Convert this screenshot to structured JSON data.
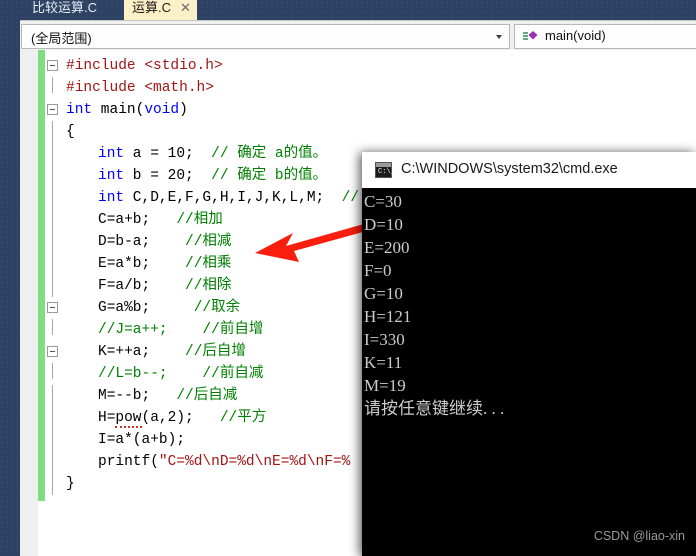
{
  "window": {
    "tabs": [
      {
        "label": "比较运算.C",
        "active": false,
        "closable": false
      },
      {
        "label": "运算.C",
        "active": true,
        "closable": true,
        "close_glyph": "✕"
      }
    ]
  },
  "navbar": {
    "scope_value": "(全局范围)",
    "member_value": "main(void)",
    "scope_icon": "chevron-down-icon",
    "member_icon": "method-purple-icon"
  },
  "editor": {
    "language": "c",
    "lines": [
      {
        "indent": 0,
        "fold": "collapse",
        "tokens": [
          {
            "t": "#include ",
            "c": "pp"
          },
          {
            "t": "<stdio.h>",
            "c": "pp"
          }
        ]
      },
      {
        "indent": 0,
        "fold": "end",
        "tokens": [
          {
            "t": "#include ",
            "c": "pp"
          },
          {
            "t": "<math.h>",
            "c": "pp"
          }
        ]
      },
      {
        "indent": 0,
        "fold": "collapse",
        "tokens": [
          {
            "t": "int",
            "c": "k"
          },
          {
            "t": " main(",
            "c": "pl"
          },
          {
            "t": "void",
            "c": "k"
          },
          {
            "t": ")",
            "c": "pl"
          }
        ]
      },
      {
        "indent": 0,
        "fold": "bar",
        "tokens": [
          {
            "t": "{",
            "c": "pl"
          }
        ]
      },
      {
        "indent": 1,
        "fold": "bar",
        "tokens": [
          {
            "t": "int",
            "c": "k"
          },
          {
            "t": " a = 10;  ",
            "c": "pl"
          },
          {
            "t": "// 确定 a的值。",
            "c": "cm"
          }
        ]
      },
      {
        "indent": 1,
        "fold": "bar",
        "tokens": [
          {
            "t": "int",
            "c": "k"
          },
          {
            "t": " b = 20;  ",
            "c": "pl"
          },
          {
            "t": "// 确定 b的值。",
            "c": "cm"
          }
        ]
      },
      {
        "indent": 1,
        "fold": "bar",
        "tokens": [
          {
            "t": "int",
            "c": "k"
          },
          {
            "t": " C,D,E,F,G,H,I,J,K,L,M;  ",
            "c": "pl"
          },
          {
            "t": "//",
            "c": "cm"
          }
        ]
      },
      {
        "indent": 1,
        "fold": "bar",
        "tokens": [
          {
            "t": "C=a+b;   ",
            "c": "pl"
          },
          {
            "t": "//相加",
            "c": "cm"
          }
        ]
      },
      {
        "indent": 1,
        "fold": "bar",
        "tokens": [
          {
            "t": "D=b-a;    ",
            "c": "pl"
          },
          {
            "t": "//相减",
            "c": "cm"
          }
        ]
      },
      {
        "indent": 1,
        "fold": "bar",
        "tokens": [
          {
            "t": "E=a*b;    ",
            "c": "pl"
          },
          {
            "t": "//相乘",
            "c": "cm"
          }
        ]
      },
      {
        "indent": 1,
        "fold": "bar",
        "tokens": [
          {
            "t": "F=a/b;    ",
            "c": "pl"
          },
          {
            "t": "//相除",
            "c": "cm"
          }
        ]
      },
      {
        "indent": 1,
        "fold": "collapse",
        "tokens": [
          {
            "t": "G=a%b;     ",
            "c": "pl"
          },
          {
            "t": "//取余",
            "c": "cm"
          }
        ]
      },
      {
        "indent": 1,
        "fold": "end",
        "tokens": [
          {
            "t": "//J=a++;    //前自增",
            "c": "cm"
          }
        ]
      },
      {
        "indent": 1,
        "fold": "collapse",
        "tokens": [
          {
            "t": "K=++a;    ",
            "c": "pl"
          },
          {
            "t": "//后自增",
            "c": "cm"
          }
        ]
      },
      {
        "indent": 1,
        "fold": "end",
        "tokens": [
          {
            "t": "//L=b--;    //前自减",
            "c": "cm"
          }
        ]
      },
      {
        "indent": 1,
        "fold": "bar",
        "tokens": [
          {
            "t": "M=--b;   ",
            "c": "pl"
          },
          {
            "t": "//后自减",
            "c": "cm"
          }
        ]
      },
      {
        "indent": 1,
        "fold": "bar",
        "tokens": [
          {
            "t": "H=",
            "c": "pl"
          },
          {
            "t": "pow",
            "c": "sq"
          },
          {
            "t": "(a,2);   ",
            "c": "pl"
          },
          {
            "t": "//平方",
            "c": "cm"
          }
        ]
      },
      {
        "indent": 1,
        "fold": "bar",
        "tokens": [
          {
            "t": "I=a*(a+b);",
            "c": "pl"
          }
        ]
      },
      {
        "indent": 1,
        "fold": "bar",
        "tokens": [
          {
            "t": "printf(",
            "c": "pl"
          },
          {
            "t": "\"C=%d\\nD=%d\\nE=%d\\nF=%",
            "c": "st"
          }
        ]
      },
      {
        "indent": 0,
        "fold": "bar",
        "tokens": [
          {
            "t": "}",
            "c": "pl"
          }
        ]
      }
    ]
  },
  "console": {
    "title": "C:\\WINDOWS\\system32\\cmd.exe",
    "icon": "cmd-icon",
    "output": [
      "C=30",
      "D=10",
      "E=200",
      "F=0",
      "G=10",
      "H=121",
      "I=330",
      "K=11",
      "M=19",
      "请按任意键继续. . ."
    ]
  },
  "annotation": {
    "arrow_color": "#fa1e0e",
    "arrow_name": "red-pointer-arrow"
  },
  "watermark": {
    "text": "CSDN @liao-xin"
  },
  "colors": {
    "chrome": "#2d4263",
    "active_tab": "#fcf0c8",
    "change_bar": "#7fdd84",
    "keyword": "#0000ff",
    "comment": "#008000",
    "string": "#a31515",
    "console_bg": "#000000",
    "console_fg": "#cccccc"
  }
}
